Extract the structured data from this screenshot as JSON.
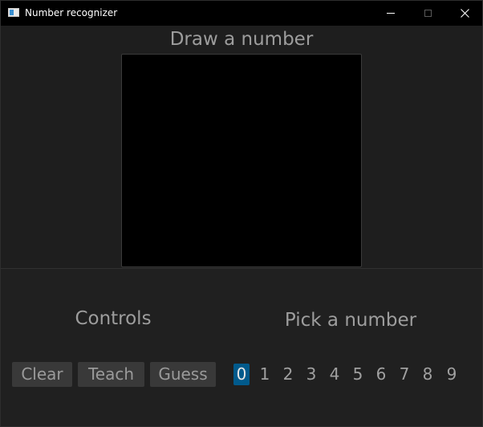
{
  "window": {
    "title": "Number recognizer",
    "controls": [
      "minimize-icon",
      "maximize-icon",
      "close-icon"
    ]
  },
  "draw_panel": {
    "title": "Draw a number"
  },
  "controls_panel": {
    "title": "Controls",
    "buttons": [
      "Clear",
      "Teach",
      "Guess"
    ]
  },
  "pick_panel": {
    "title": "Pick a number",
    "digits": [
      "0",
      "1",
      "2",
      "3",
      "4",
      "5",
      "6",
      "7",
      "8",
      "9"
    ],
    "selected": "0"
  },
  "colors": {
    "selected_digit_bg": "#005a8c",
    "button_bg": "#393939",
    "canvas": "#000000"
  }
}
